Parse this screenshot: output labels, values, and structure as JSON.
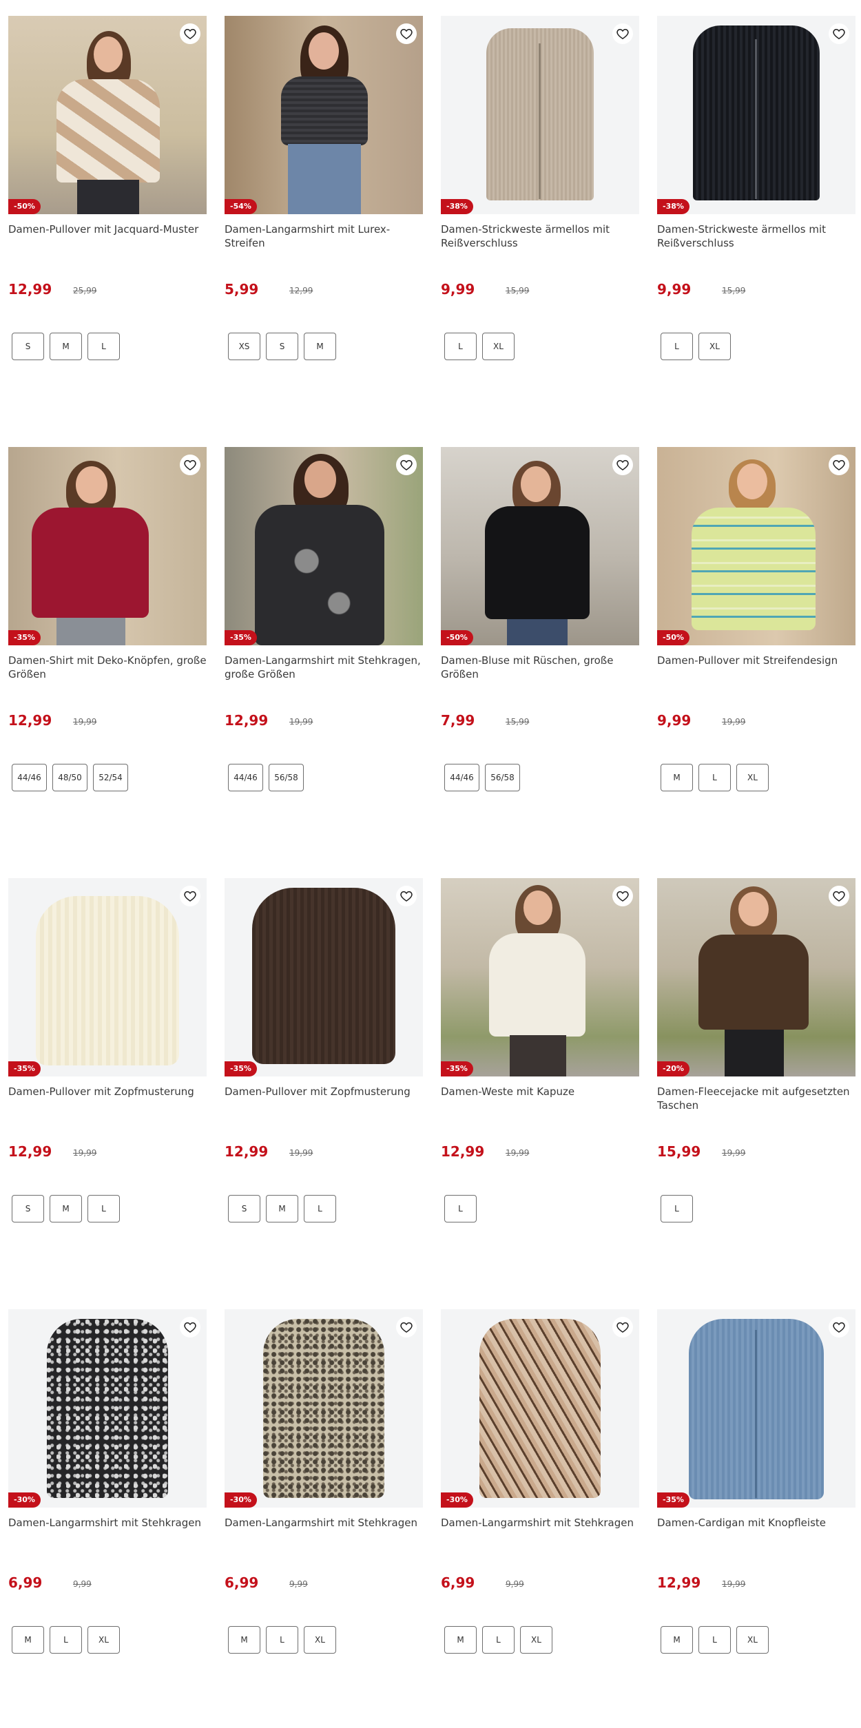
{
  "products": [
    {
      "title": "Damen-Pullover mit Jacquard-Muster",
      "price": "12,99",
      "old_price": "25,99",
      "discount": "-50%",
      "sizes": [
        "S",
        "M",
        "L"
      ]
    },
    {
      "title": "Damen-Langarmshirt mit Lurex-Streifen",
      "price": "5,99",
      "old_price": "12,99",
      "discount": "-54%",
      "sizes": [
        "XS",
        "S",
        "M"
      ]
    },
    {
      "title": "Damen-Strickweste ärmellos mit Reißverschluss",
      "price": "9,99",
      "old_price": "15,99",
      "discount": "-38%",
      "sizes": [
        "L",
        "XL"
      ]
    },
    {
      "title": "Damen-Strickweste ärmellos mit Reißverschluss",
      "price": "9,99",
      "old_price": "15,99",
      "discount": "-38%",
      "sizes": [
        "L",
        "XL"
      ]
    },
    {
      "title": "Damen-Shirt mit Deko-Knöpfen, große Größen",
      "price": "12,99",
      "old_price": "19,99",
      "discount": "-35%",
      "sizes": [
        "44/46",
        "48/50",
        "52/54"
      ]
    },
    {
      "title": "Damen-Langarmshirt mit Stehkragen, große Größen",
      "price": "12,99",
      "old_price": "19,99",
      "discount": "-35%",
      "sizes": [
        "44/46",
        "56/58"
      ]
    },
    {
      "title": "Damen-Bluse mit Rüschen, große Größen",
      "price": "7,99",
      "old_price": "15,99",
      "discount": "-50%",
      "sizes": [
        "44/46",
        "56/58"
      ]
    },
    {
      "title": "Damen-Pullover mit Streifendesign",
      "price": "9,99",
      "old_price": "19,99",
      "discount": "-50%",
      "sizes": [
        "M",
        "L",
        "XL"
      ]
    },
    {
      "title": "Damen-Pullover mit Zopfmusterung",
      "price": "12,99",
      "old_price": "19,99",
      "discount": "-35%",
      "sizes": [
        "S",
        "M",
        "L"
      ]
    },
    {
      "title": "Damen-Pullover mit Zopfmusterung",
      "price": "12,99",
      "old_price": "19,99",
      "discount": "-35%",
      "sizes": [
        "S",
        "M",
        "L"
      ]
    },
    {
      "title": "Damen-Weste mit Kapuze",
      "price": "12,99",
      "old_price": "19,99",
      "discount": "-35%",
      "sizes": [
        "L"
      ]
    },
    {
      "title": "Damen-Fleecejacke mit aufgesetzten Taschen",
      "price": "15,99",
      "old_price": "19,99",
      "discount": "-20%",
      "sizes": [
        "L"
      ]
    },
    {
      "title": "Damen-Langarmshirt mit Stehkragen",
      "price": "6,99",
      "old_price": "9,99",
      "discount": "-30%",
      "sizes": [
        "M",
        "L",
        "XL"
      ]
    },
    {
      "title": "Damen-Langarmshirt mit Stehkragen",
      "price": "6,99",
      "old_price": "9,99",
      "discount": "-30%",
      "sizes": [
        "M",
        "L",
        "XL"
      ]
    },
    {
      "title": "Damen-Langarmshirt mit Stehkragen",
      "price": "6,99",
      "old_price": "9,99",
      "discount": "-30%",
      "sizes": [
        "M",
        "L",
        "XL"
      ]
    },
    {
      "title": "Damen-Cardigan mit Knopfleiste",
      "price": "12,99",
      "old_price": "19,99",
      "discount": "-35%",
      "sizes": [
        "M",
        "L",
        "XL"
      ]
    }
  ],
  "colors": {
    "price_red": "#c4111b",
    "badge_red": "#c4111b",
    "text": "#3a3a3a",
    "strike": "#6a6a6a",
    "border": "#6e6e6e"
  },
  "icons": {
    "wishlist": "heart-outline-icon"
  }
}
